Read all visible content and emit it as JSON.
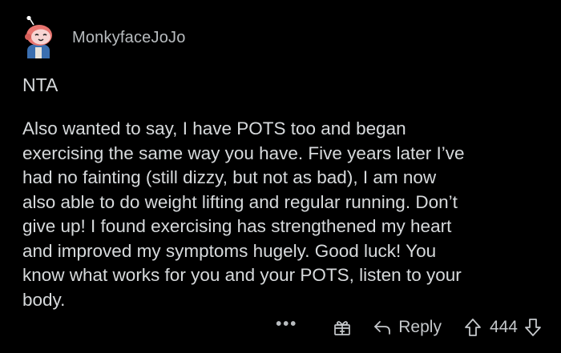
{
  "comment": {
    "username": "MonkyfaceJoJo",
    "verdict": "NTA",
    "body_lines": [
      "Also wanted to say, I have POTS too and began",
      "exercising the same way you have. Five years later I’ve",
      "had no fainting (still dizzy, but not as bad), I am now",
      "also able to do weight lifting and regular running. Don’t",
      "give up! I found exercising has strengthened my heart",
      "and improved my symptoms hugely. Good luck! You",
      "know what works for you and your POTS, listen to your",
      "body."
    ]
  },
  "actions": {
    "more_label": "•••",
    "reply_label": "Reply",
    "vote_count": "444"
  },
  "icons": {
    "avatar": "snoo-avatar-icon",
    "more": "more-options-icon",
    "award": "gift-award-icon",
    "reply": "reply-arrow-icon",
    "upvote": "upvote-arrow-icon",
    "downvote": "downvote-arrow-icon"
  },
  "colors": {
    "background": "#000000",
    "text": "#d7dadc",
    "muted": "#b8bcbf",
    "avatar_face": "#f4c6c8",
    "avatar_hood": "#e8746f",
    "avatar_body": "#3b6fb0"
  }
}
